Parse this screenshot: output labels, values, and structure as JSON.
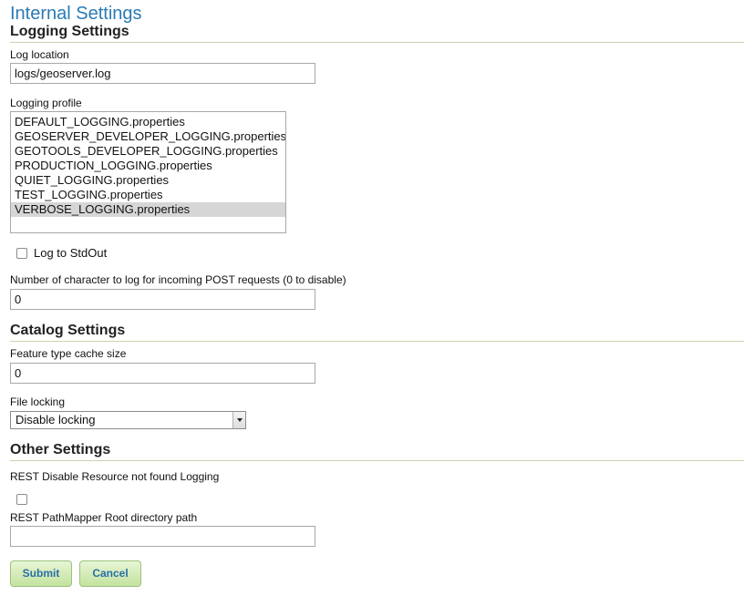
{
  "page": {
    "title": "Internal Settings"
  },
  "logging": {
    "section_title": "Logging Settings",
    "log_location_label": "Log location",
    "log_location_value": "logs/geoserver.log",
    "profile_label": "Logging profile",
    "profiles": [
      "DEFAULT_LOGGING.properties",
      "GEOSERVER_DEVELOPER_LOGGING.properties",
      "GEOTOOLS_DEVELOPER_LOGGING.properties",
      "PRODUCTION_LOGGING.properties",
      "QUIET_LOGGING.properties",
      "TEST_LOGGING.properties",
      "VERBOSE_LOGGING.properties"
    ],
    "selected_profile": "VERBOSE_LOGGING.properties",
    "stdout_label": "Log to StdOut",
    "post_chars_label": "Number of character to log for incoming POST requests (0 to disable)",
    "post_chars_value": "0"
  },
  "catalog": {
    "section_title": "Catalog Settings",
    "cache_size_label": "Feature type cache size",
    "cache_size_value": "0",
    "file_locking_label": "File locking",
    "file_locking_value": "Disable locking"
  },
  "other": {
    "section_title": "Other Settings",
    "rest_disable_label": "REST Disable Resource not found Logging",
    "rest_root_label": "REST PathMapper Root directory path",
    "rest_root_value": ""
  },
  "actions": {
    "submit_label": "Submit",
    "cancel_label": "Cancel"
  },
  "colors": {
    "title_blue": "#2a7ab5",
    "button_green": "#c3e39e",
    "section_rule": "#c9d3b2"
  }
}
